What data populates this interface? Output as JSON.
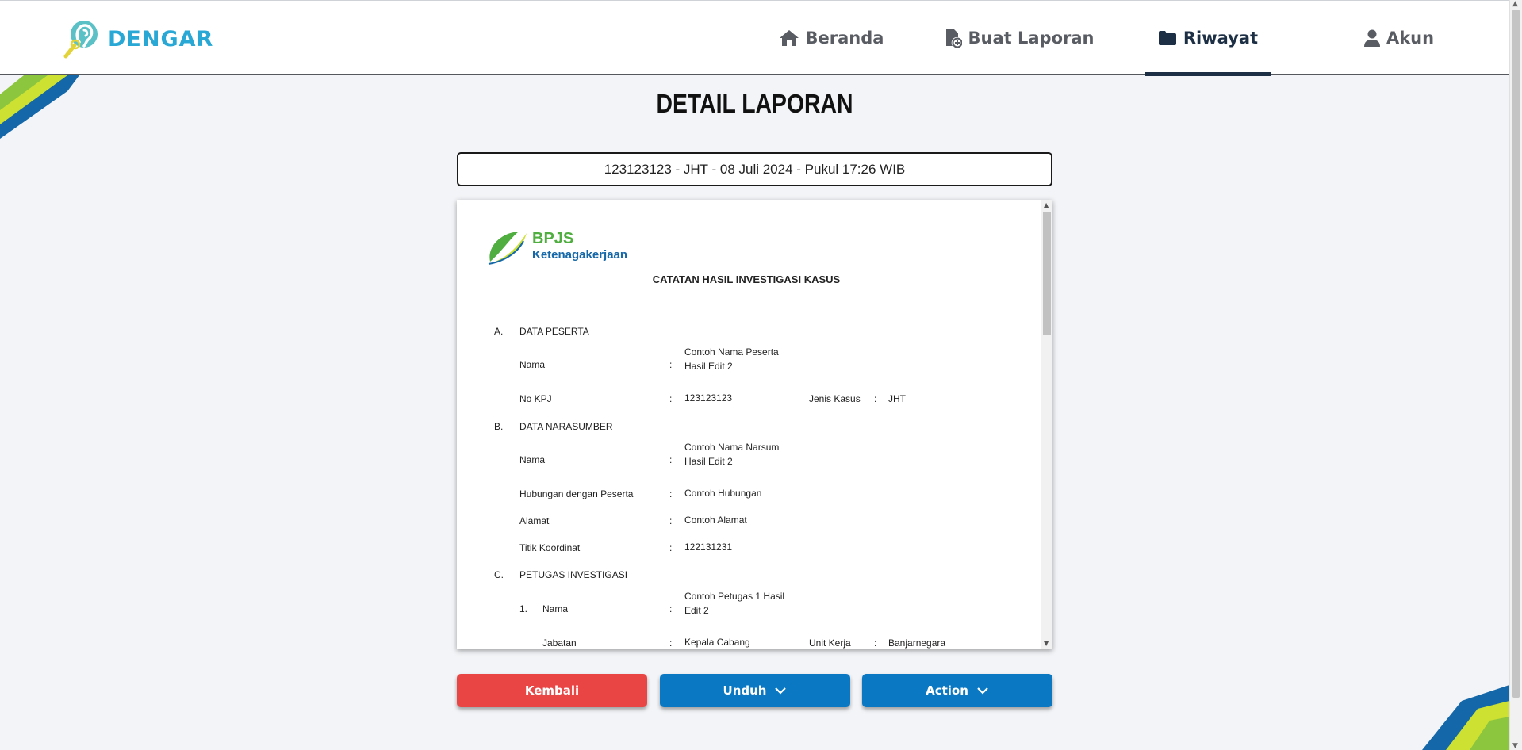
{
  "brand": {
    "name": "DENGAR",
    "color": "#29a8d6"
  },
  "nav": [
    {
      "label": "Beranda",
      "icon": "home-icon",
      "active": false
    },
    {
      "label": "Buat Laporan",
      "icon": "file-add-icon",
      "active": false
    },
    {
      "label": "Riwayat",
      "icon": "folder-icon",
      "active": true
    },
    {
      "label": "Akun",
      "icon": "user-icon",
      "active": false
    }
  ],
  "page": {
    "title": "DETAIL LAPORAN"
  },
  "report_selector": {
    "value": "123123123 - JHT - 08 Juli 2024 - Pukul 17:26 WIB"
  },
  "document": {
    "logo_line1": "BPJS",
    "logo_line2": "Ketenagakerjaan",
    "heading": "CATATAN HASIL INVESTIGASI KASUS",
    "section_a": {
      "letter": "A.",
      "title": "DATA PESERTA"
    },
    "peserta": {
      "nama_label": "Nama",
      "nama_value_1": "Contoh Nama Peserta",
      "nama_value_2": "Hasil Edit 2",
      "kpj_label": "No KPJ",
      "kpj_value": "123123123",
      "jenis_label": "Jenis Kasus",
      "jenis_value": "JHT"
    },
    "section_b": {
      "letter": "B.",
      "title": "DATA NARASUMBER"
    },
    "narasumber": {
      "nama_label": "Nama",
      "nama_value_1": "Contoh Nama Narsum",
      "nama_value_2": "Hasil Edit 2",
      "hubungan_label": "Hubungan dengan Peserta",
      "hubungan_value": "Contoh Hubungan",
      "alamat_label": "Alamat",
      "alamat_value": "Contoh Alamat",
      "titik_label": "Titik Koordinat",
      "titik_value": "122131231"
    },
    "section_c": {
      "letter": "C.",
      "title": "PETUGAS INVESTIGASI"
    },
    "petugas": {
      "no": "1.",
      "nama_label": "Nama",
      "nama_value_1": "Contoh Petugas 1 Hasil",
      "nama_value_2": "Edit 2",
      "jabatan_label": "Jabatan",
      "jabatan_value": "Kepala Cabang",
      "unit_label": "Unit Kerja",
      "unit_value": "Banjarnegara"
    },
    "colon": ":"
  },
  "buttons": {
    "back": "Kembali",
    "download": "Unduh",
    "action": "Action"
  },
  "colors": {
    "back": "#e94545",
    "primary": "#0a78c3",
    "nav_active": "#1d2f45"
  }
}
